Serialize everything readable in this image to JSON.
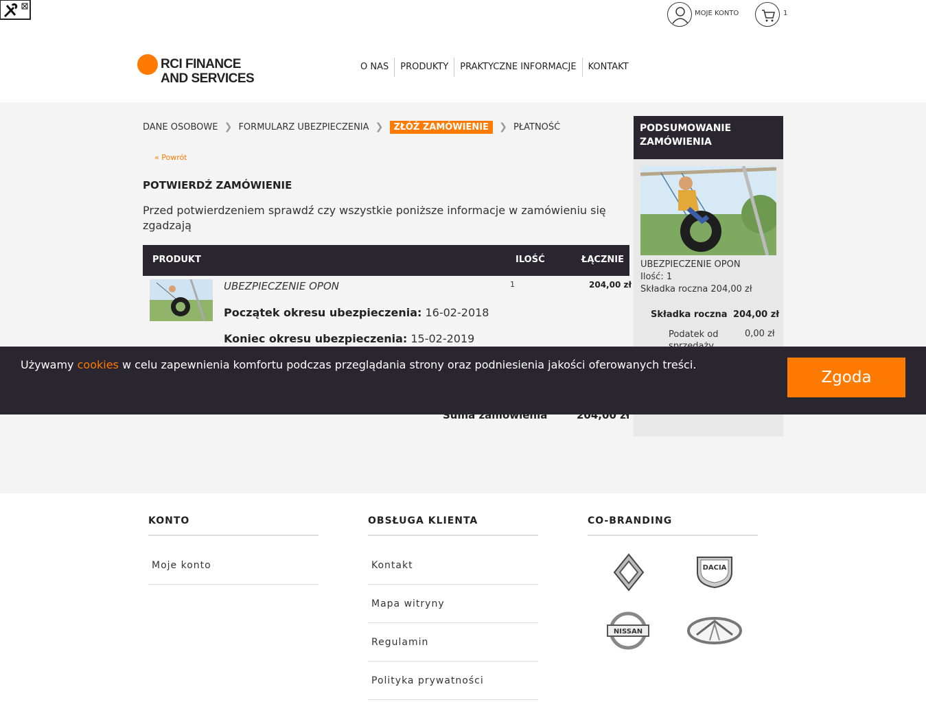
{
  "header": {
    "account_label": "MOJE KONTO",
    "cart_count": "1",
    "logo_line1": "RCI FINANCE",
    "logo_line2": "AND SERVICES",
    "nav": [
      "O NAS",
      "PRODUKTY",
      "PRAKTYCZNE INFORMACJE",
      "KONTAKT"
    ]
  },
  "steps": [
    "DANE OSOBOWE",
    "FORMULARZ UBEZPIECZENIA",
    "ZŁÓŻ ZAMÓWIENIE",
    "PŁATNOŚĆ"
  ],
  "back_link": "« Powrót",
  "page_title": "POTWIERDŹ ZAMÓWIENIE",
  "intro": "Przed potwierdzeniem sprawdź czy wszystkie poniższe informacje w zamówieniu się zgadzają",
  "table": {
    "headers": {
      "product": "PRODUKT",
      "qty": "ILOŚĆ",
      "total": "ŁĄCZNIE"
    },
    "row": {
      "name": "UBEZPIECZENIE OPON",
      "qty": "1",
      "total": "204,00 zł",
      "start_label": "Początek okresu ubezpieczenia:",
      "start_value": " 16-02-2018",
      "end_label": "Koniec okresu ubezpieczenia:",
      "end_value": " 15-02-2019"
    },
    "sum_label": "Suma zamówienia",
    "sum_value": "204,00 zł"
  },
  "summary": {
    "title": "PODSUMOWANIE ZAMÓWIENIA",
    "product": "UBEZPIECZENIE OPON",
    "qty": "Ilość: 1",
    "premium_line": "Składka roczna 204,00 zł",
    "k1": "Składka roczna",
    "v1": "204,00 zł",
    "k2": "Podatek od sprzedaży",
    "v2": "0,00 zł"
  },
  "cookie": {
    "before": "Używamy ",
    "link": "cookies",
    "after": " w celu zapewnienia komfortu podczas przeglądania strony oraz podniesienia jakości oferowanych treści.",
    "button": "Zgoda"
  },
  "footer": {
    "col1_title": "KONTO",
    "col1_items": [
      "Moje konto"
    ],
    "col2_title": "OBSŁUGA KLIENTA",
    "col2_items": [
      "Kontakt",
      "Mapa witryny",
      "Regulamin",
      "Polityka prywatności"
    ],
    "col3_title": "CO-BRANDING",
    "brands": [
      "renault-logo",
      "dacia-logo",
      "nissan-logo",
      "infiniti-logo"
    ],
    "brand_texts": {
      "dacia": "DACIA",
      "nissan": "NISSAN"
    }
  },
  "colors": {
    "accent": "#ff7a00",
    "dark": "#2a2630",
    "gray_bg": "#f4f4f4"
  }
}
